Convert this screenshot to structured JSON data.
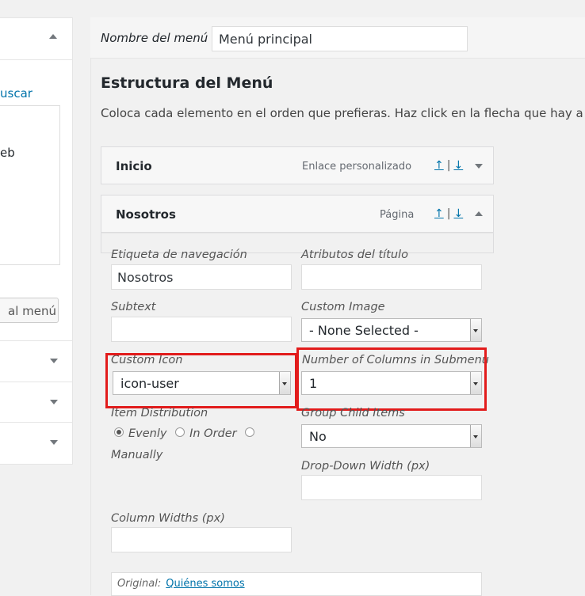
{
  "sidebar": {
    "buscar_link": "uscar",
    "list_fragment": "eb",
    "add_to_menu_button": "al menú"
  },
  "menu_name": {
    "label": "Nombre del menú",
    "value": "Menú principal"
  },
  "structure": {
    "title": "Estructura del Menú",
    "description": "Coloca cada elemento en el orden que prefieras. Haz click en la flecha que hay a la"
  },
  "menu_items": [
    {
      "title": "Inicio",
      "type": "Enlace personalizado",
      "move_up": "↑",
      "separator": "|",
      "move_down": "↓"
    },
    {
      "title": "Nosotros",
      "type": "Página",
      "move_up": "↑",
      "separator": "|",
      "move_down": "↓"
    }
  ],
  "item_settings": {
    "nav_label": {
      "label": "Etiqueta de navegación",
      "value": "Nosotros"
    },
    "title_attr": {
      "label": "Atributos del título",
      "value": ""
    },
    "subtext": {
      "label": "Subtext",
      "value": ""
    },
    "custom_image": {
      "label": "Custom Image",
      "value": "- None Selected -"
    },
    "custom_icon": {
      "label": "Custom Icon",
      "value": "icon-user"
    },
    "num_columns": {
      "label": "Number of Columns in Submenu",
      "value": "1"
    },
    "item_distribution": {
      "label": "Item Distribution",
      "options": [
        "Evenly",
        "In Order",
        "Manually"
      ],
      "selected": "Evenly"
    },
    "group_child_items": {
      "label": "Group Child Items",
      "value": "No"
    },
    "dropdown_width": {
      "label": "Drop-Down Width (px)",
      "value": ""
    },
    "column_widths": {
      "label": "Column Widths (px)",
      "value": ""
    },
    "original": {
      "label": "Original:",
      "link": "Quiénes somos"
    }
  },
  "colors": {
    "highlight": "#e21c1c",
    "link": "#0073aa"
  }
}
